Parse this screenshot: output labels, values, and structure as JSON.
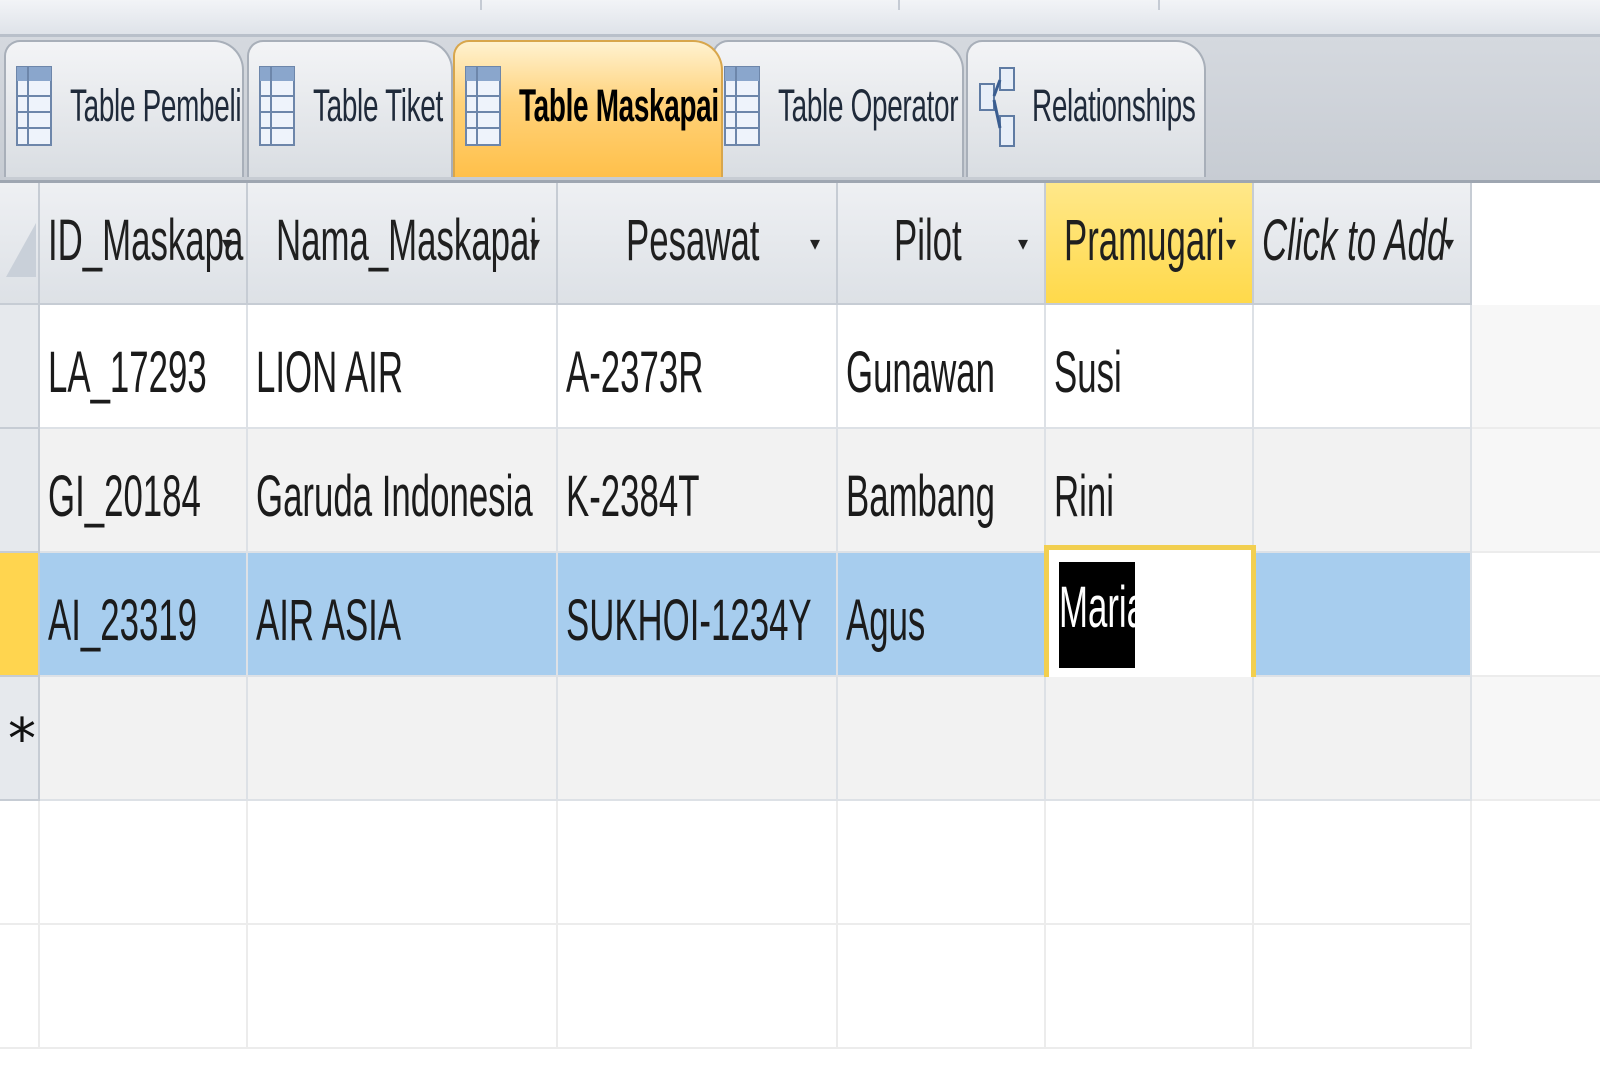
{
  "tabs": [
    {
      "label": "Table Pembeli",
      "icon": "table-icon",
      "active": false
    },
    {
      "label": "Table Tiket",
      "icon": "table-icon",
      "active": false
    },
    {
      "label": "Table Maskapai",
      "icon": "table-icon",
      "active": true
    },
    {
      "label": "Table Operator",
      "icon": "table-icon",
      "active": false
    },
    {
      "label": "Relationships",
      "icon": "relationships-icon",
      "active": false
    }
  ],
  "columns": [
    {
      "label": "ID_Maskapa",
      "dropdown": "▾"
    },
    {
      "label": "Nama_Maskapai",
      "dropdown": "▾"
    },
    {
      "label": "Pesawat",
      "dropdown": "▾"
    },
    {
      "label": "Pilot",
      "dropdown": "▾"
    },
    {
      "label": "Pramugari",
      "dropdown": "▾"
    },
    {
      "label": "Click to Add",
      "dropdown": "▾"
    }
  ],
  "rows": [
    {
      "id": "LA_17293",
      "nama": "LION AIR",
      "pesawat": "A-2373R",
      "pilot": "Gunawan",
      "pramugari": "Susi",
      "add": ""
    },
    {
      "id": "GI_20184",
      "nama": "Garuda Indonesia",
      "pesawat": "K-2384T",
      "pilot": "Bambang",
      "pramugari": "Rini",
      "add": ""
    },
    {
      "id": "AI_23319",
      "nama": "AIR ASIA",
      "pesawat": "SUKHOI-1234Y",
      "pilot": "Agus",
      "pramugari": "Maria",
      "add": ""
    }
  ],
  "new_row_marker": "*",
  "colors": {
    "active_tab": "#ffc04a",
    "current_row": "#a7cdee",
    "selected_header": "#ffd94a",
    "edit_border": "#f2cf4f"
  }
}
